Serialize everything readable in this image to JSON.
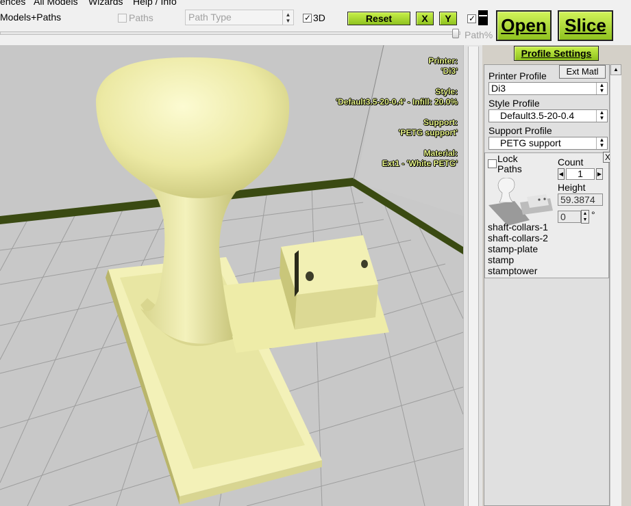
{
  "menu": [
    "ences",
    "All Models",
    "Wizards",
    "Help / Info"
  ],
  "toolbar": {
    "view_label": "Models+Paths",
    "paths_label": "Paths",
    "paths_checked": false,
    "path_type_placeholder": "Path Type",
    "three_d_label": "3D",
    "three_d_checked": true,
    "reset_label": "Reset",
    "x_label": "X",
    "y_label": "Y",
    "open_label": "Open",
    "slice_label": "Slice",
    "path_pct_label": "Path%",
    "slider_value": 1.0
  },
  "overlay": {
    "printer_label": "Printer:",
    "printer_value": "'Di3'",
    "style_label": "Style:",
    "style_value": "'Default3.5-20-0.4' - Infill: 20.0%",
    "support_label": "Support:",
    "support_value": "'PETG support'",
    "material_label": "Material:",
    "material_value": "Ext1 - 'White PETG'"
  },
  "panel": {
    "profile_settings_label": "Profile Settings",
    "ext_matl_label": "Ext Matl",
    "printer_profile_label": "Printer Profile",
    "printer_profile_value": "Di3",
    "style_profile_label": "Style Profile",
    "style_profile_value": "Default3.5-20-0.4",
    "support_profile_label": "Support Profile",
    "support_profile_value": "PETG support",
    "lock_paths_label_1": "Lock",
    "lock_paths_label_2": "Paths",
    "lock_paths_checked": false,
    "count_label": "Count",
    "count_value": "1",
    "close_label": "X",
    "height_label": "Height",
    "height_value": "59.3874",
    "rotation_value": "0",
    "degree_symbol": "°",
    "models": [
      "shaft-collars-1",
      "shaft-collars-2",
      "stamp-plate",
      "stamp",
      "stamptower"
    ]
  },
  "colors": {
    "accent_green": "#a6d630",
    "model_yellow": "#f2f0b4",
    "overlay_text": "#e8f58a",
    "floor_gray": "#c9c9c9",
    "bed_edge": "#3a4a12"
  }
}
